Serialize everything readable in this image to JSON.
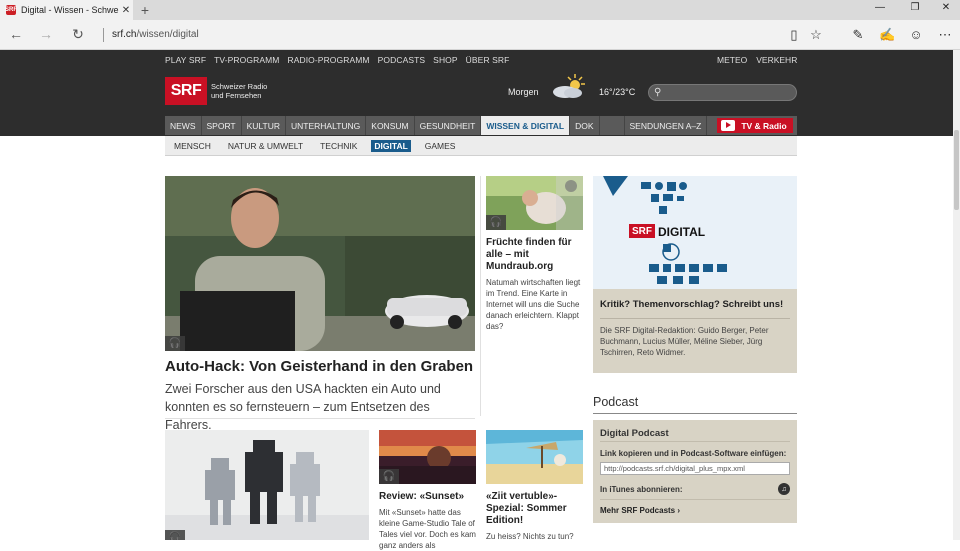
{
  "browser": {
    "tab_title": "Digital - Wissen - Schweiz",
    "favicon": "SRF",
    "url_host": "srf.ch",
    "url_path": "/wissen/digital",
    "close_tab": "✕",
    "new_tab": "+",
    "minimize": "—",
    "restore": "❐",
    "close_window": "✕",
    "back": "←",
    "forward": "→",
    "refresh": "↻",
    "reading_view": "▯",
    "favorite": "☆",
    "hub": "✎",
    "note": "✍",
    "feedback": "☺",
    "more": "⋯"
  },
  "site": {
    "toplinks": [
      "PLAY SRF",
      "TV-PROGRAMM",
      "RADIO-PROGRAMM",
      "PODCASTS",
      "SHOP",
      "ÜBER SRF"
    ],
    "toplinks_right": [
      "METEO",
      "VERKEHR"
    ],
    "logo": "SRF",
    "logo_line1": "Schweizer Radio",
    "logo_line2": "und Fernsehen",
    "weather_label": "Morgen",
    "weather_temp": "16°/23°C",
    "search_icon": "⚲",
    "mainnav": [
      "NEWS",
      "SPORT",
      "KULTUR",
      "UNTERHALTUNG",
      "KONSUM",
      "GESUNDHEIT",
      "WISSEN & DIGITAL",
      "DOK"
    ],
    "sendungen": "SENDUNGEN A–Z",
    "tv_radio": "TV & Radio",
    "subnav": [
      "MENSCH",
      "NATUR & UMWELT",
      "TECHNIK",
      "DIGITAL",
      "GAMES"
    ],
    "colors": {
      "brand_red": "#c91024",
      "accent_blue": "#1a5c8c"
    }
  },
  "content": {
    "hero_title": "Auto-Hack: Von Geisterhand in den Graben",
    "hero_lead": "Zwei Forscher aus den USA hackten ein Auto und konnten es so fernsteuern – zum Entsetzen des Fahrers.",
    "card1_title": "Früchte finden für alle – mit Mundraub.org",
    "card1_desc": "Natumah wirtschaften liegt im Trend. Eine Karte in Internet will uns die Suche danach erleichtern. Klappt das?",
    "card2_title": "Review: «Sunset»",
    "card2_desc": "Mit «Sunset» hatte das kleine Game-Studio Tale of Tales viel vor. Doch es kam ganz anders als",
    "card3_title": "«Ziit vertuble»-Spezial: Sommer Edition!",
    "card3_desc": "Zu heiss? Nichts zu tun?",
    "promo_brand": "SRF",
    "promo_brand_word": "DIGITAL",
    "promo_title": "Kritik? Themenvorschlag? Schreibt uns!",
    "promo_desc": "Die SRF Digital-Redaktion: Guido Berger, Peter Buchmann, Lucius Müller, Méline Sieber, Jürg Tschirren, Reto Widmer.",
    "podcast_heading": "Podcast",
    "podcast_box_title": "Digital Podcast",
    "podcast_link_label": "Link kopieren und in Podcast-Software einfügen:",
    "podcast_url": "http://podcasts.srf.ch/digital_plus_mpx.xml",
    "itunes_label": "In iTunes abonnieren:",
    "more_podcasts": "Mehr SRF Podcasts ›",
    "audio_icon": "🎧"
  }
}
